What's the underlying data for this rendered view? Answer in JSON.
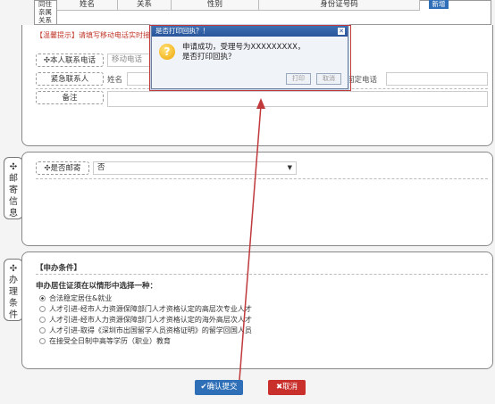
{
  "top_table": {
    "row_label": "同住\n亲属\n关系",
    "headers": [
      "姓名",
      "关系",
      "性别",
      "身份证号码"
    ],
    "add_button": "新增"
  },
  "warm_tip": "【温馨提示】请填写移动电话实时接收",
  "contact": {
    "phone_label": "本人联系电话",
    "phone_field": "移动电话",
    "emergency_label": "紧急联系人",
    "emergency_name_label": "姓名",
    "fixed_phone_label": "固定电话",
    "remark_label": "备注"
  },
  "mail": {
    "side_tab": "邮\n寄\n信\n息",
    "is_mail_label": "是否邮寄",
    "is_mail_value": "否"
  },
  "conditions": {
    "side_tab": "办\n理\n条\n件",
    "section_title": "【申办条件】",
    "choose_label": "申办居住证须在以情形中选择一种：",
    "options": [
      {
        "label": "合法稳定居住&就业",
        "selected": true
      },
      {
        "label": "人才引进-经市人力资源保障部门人才资格认定的高层次专业人才",
        "selected": false
      },
      {
        "label": "人才引进-经市人力资源保障部门人才资格认定的海外高层次人才",
        "selected": false
      },
      {
        "label": "人才引进-取得《深圳市出国留学人员资格证明》的留学回国人员",
        "selected": false
      },
      {
        "label": "在接受全日制中高等学历（职业）教育",
        "selected": false
      }
    ]
  },
  "buttons": {
    "submit": "✔确认提交",
    "cancel": "✖取消"
  },
  "dialog": {
    "title": "是否打印回执？！",
    "message_line1": "申请成功，受理号为XXXXXXXXX，",
    "message_line2": "是否打印回执？",
    "print": "打印",
    "cancel": "取消"
  },
  "colors": {
    "primary": "#2f6fb7",
    "danger": "#c9302c",
    "annotation": "#c0393b"
  }
}
